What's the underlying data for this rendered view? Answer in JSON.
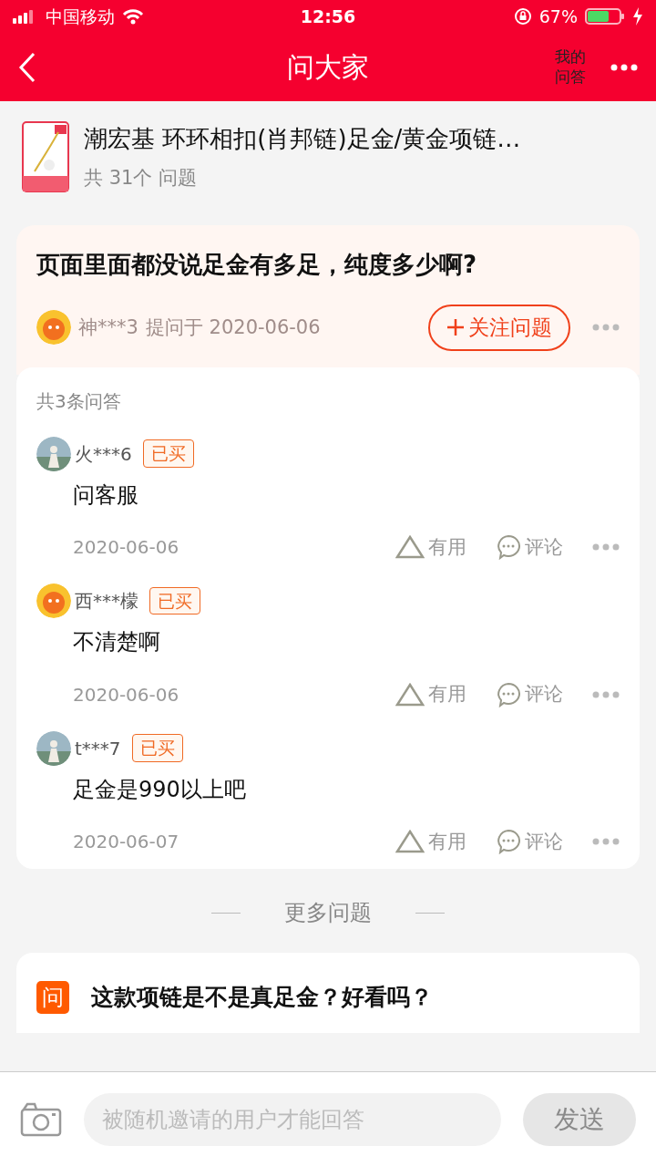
{
  "status_bar": {
    "carrier": "中国移动",
    "time": "12:56",
    "battery": "67%"
  },
  "header": {
    "title": "问大家",
    "my_answers": "我的问答"
  },
  "product": {
    "title": "潮宏基 环环相扣(肖邦链)足金/黄金项链…",
    "count": "共 31个 问题"
  },
  "question": {
    "title": "页面里面都没说足金有多足，纯度多少啊?",
    "asker": "神***3",
    "asked_at": "提问于 2020-06-06",
    "follow_button": "关注问题",
    "kind": "mascot"
  },
  "answers": {
    "count": "共3条问答",
    "items": [
      {
        "user": "火***6",
        "kind": "photo",
        "badge": "已买",
        "text": "问客服",
        "date": "2020-06-06",
        "useful": "有用",
        "comment": "评论"
      },
      {
        "user": "西***檬",
        "kind": "mascot",
        "badge": "已买",
        "text": "不清楚啊",
        "date": "2020-06-06",
        "useful": "有用",
        "comment": "评论"
      },
      {
        "user": "t***7",
        "kind": "photo",
        "badge": "已买",
        "text": "足金是990以上吧",
        "date": "2020-06-07",
        "useful": "有用",
        "comment": "评论"
      }
    ]
  },
  "more_questions": {
    "heading": "更多问题",
    "items": [
      {
        "icon": "问",
        "title": "这款项链是不是真足金？好看吗？"
      }
    ]
  },
  "composer": {
    "placeholder": "被随机邀请的用户才能回答",
    "send_button": "发送"
  }
}
